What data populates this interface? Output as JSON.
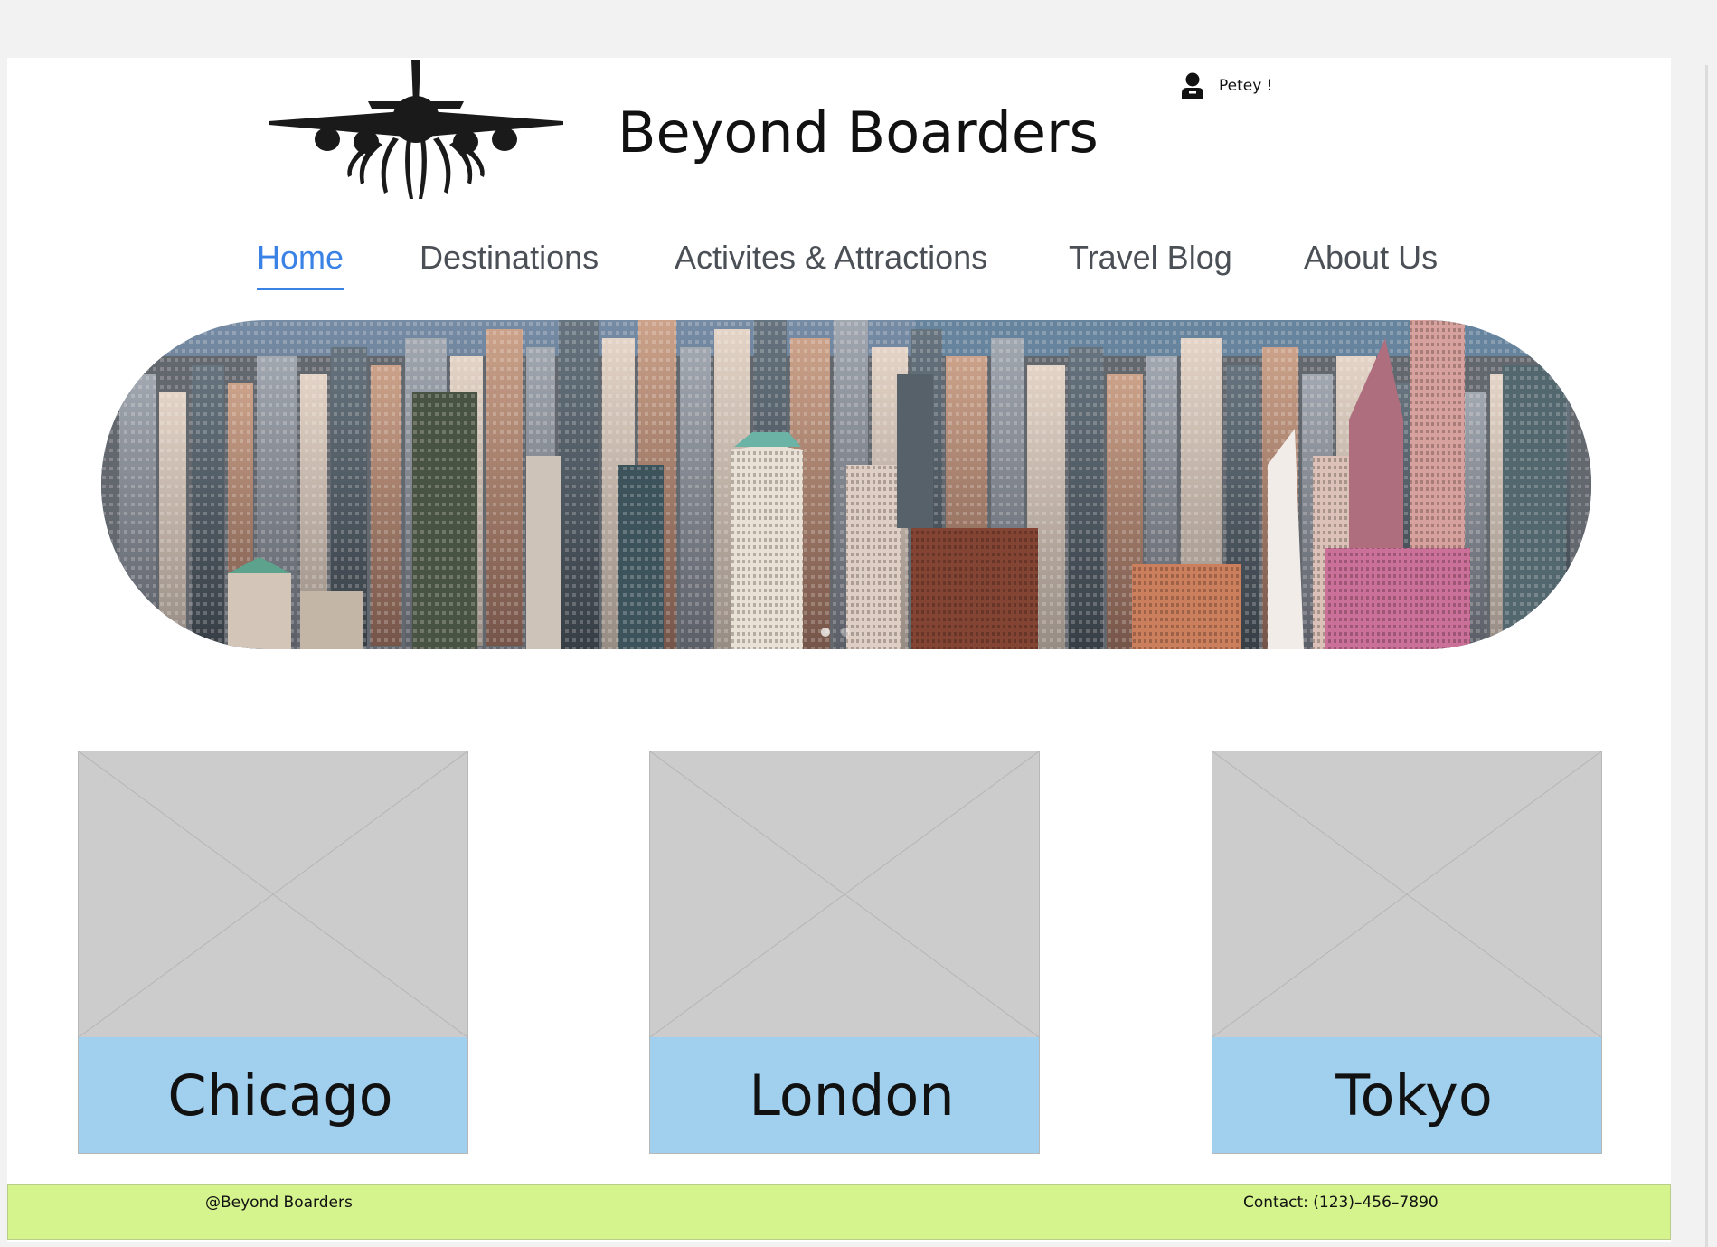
{
  "header": {
    "site_title": "Beyond Boarders",
    "user_name": "Petey !"
  },
  "nav": {
    "items": [
      {
        "label": "Home",
        "active": true
      },
      {
        "label": "Destinations",
        "active": false
      },
      {
        "label": "Activites & Attractions",
        "active": false
      },
      {
        "label": "Travel Blog",
        "active": false
      },
      {
        "label": "About Us",
        "active": false
      }
    ]
  },
  "hero": {
    "image": "city-skyline-aerial",
    "carousel_dots": 2,
    "active_dot": 1
  },
  "destinations": {
    "cards": [
      {
        "name": "Chicago",
        "image": "image-placeholder"
      },
      {
        "name": "London",
        "image": "image-placeholder"
      },
      {
        "name": "Tokyo",
        "image": "image-placeholder"
      }
    ]
  },
  "footer": {
    "copyright": "@Beyond Boarders",
    "contact": "Contact: (123)–456–7890"
  },
  "colors": {
    "accent": "#3b82e6",
    "card_label_bg": "#a1cfee",
    "footer_bg": "#d5f48e",
    "placeholder_bg": "#cccccc"
  }
}
